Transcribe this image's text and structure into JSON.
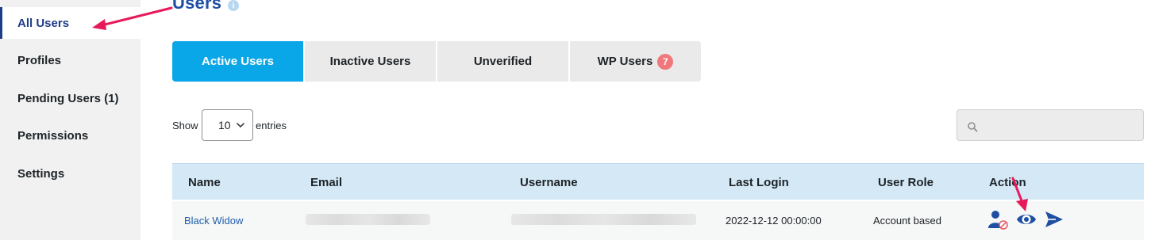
{
  "sidebar": {
    "items": [
      {
        "label": "All Users"
      },
      {
        "label": "Profiles"
      },
      {
        "label": "Pending Users (1)"
      },
      {
        "label": "Permissions"
      },
      {
        "label": "Settings"
      }
    ]
  },
  "header": {
    "title": "Users",
    "info_icon": "i"
  },
  "tabs": [
    {
      "label": "Active Users"
    },
    {
      "label": "Inactive Users"
    },
    {
      "label": "Unverified"
    },
    {
      "label": "WP Users",
      "badge": "7"
    }
  ],
  "table_controls": {
    "show_label": "Show",
    "entries_value": "10",
    "entries_label": "entries",
    "search_value": ""
  },
  "table": {
    "columns": [
      "Name",
      "Email",
      "Username",
      "Last Login",
      "User Role",
      "Action"
    ],
    "rows": [
      {
        "name": "Black Widow",
        "last_login": "2022-12-12 00:00:00",
        "user_role": "Account based"
      }
    ]
  },
  "colors": {
    "accent": "#0aa7e8",
    "title": "#1f4fa3",
    "badge": "#f0787c",
    "header_row": "#d4e8f6",
    "annotation": "#e8195a"
  },
  "icons": {
    "action_1": "deactivate-user-icon",
    "action_2": "view-eye-icon",
    "action_3": "send-arrow-icon"
  }
}
